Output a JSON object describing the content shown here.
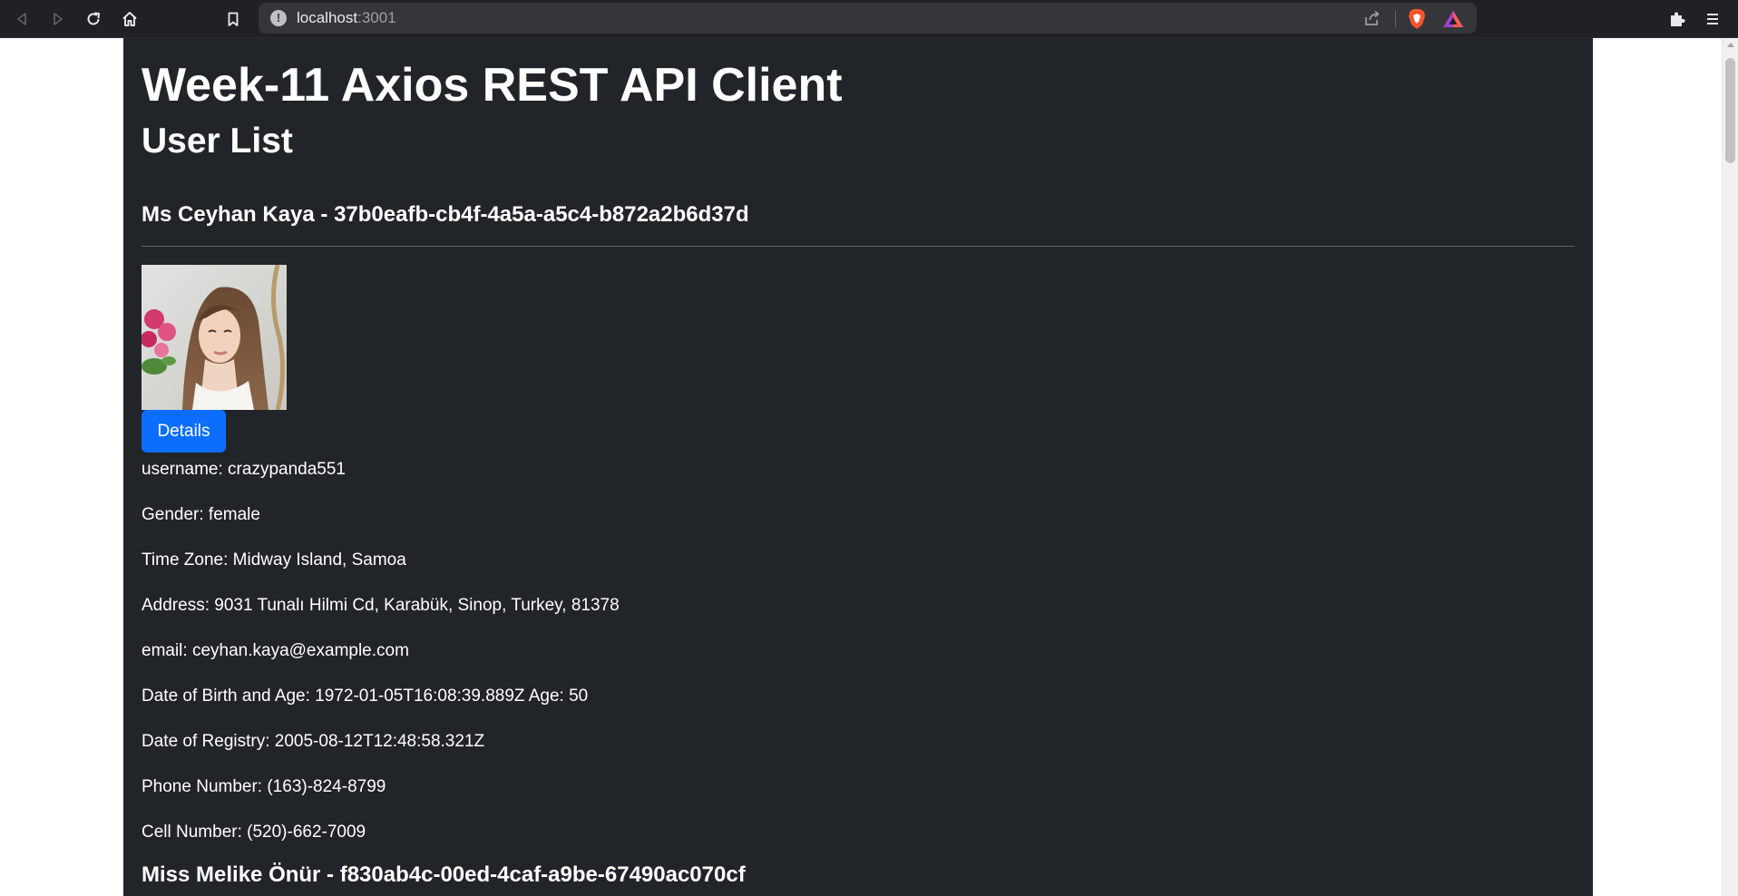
{
  "browser": {
    "url_host": "localhost",
    "url_port": ":3001",
    "icons": {
      "back": "back-arrow-icon",
      "forward": "forward-arrow-icon",
      "reload": "reload-icon",
      "home": "home-icon",
      "bookmark": "bookmark-icon",
      "site_info": "info-icon",
      "share": "share-icon",
      "brave_shields": "brave-shields-icon",
      "brave_rewards": "brave-rewards-icon",
      "extensions": "puzzle-icon",
      "menu": "hamburger-menu-icon"
    }
  },
  "page": {
    "title": "Week-11 Axios REST API Client",
    "subtitle": "User List",
    "colors": {
      "background": "#212529",
      "button": "#0d6efd",
      "text": "#ffffff"
    }
  },
  "users": [
    {
      "heading": "Ms Ceyhan Kaya - 37b0eafb-cb4f-4a5a-a5c4-b872a2b6d37d",
      "button_label": "Details",
      "fields": [
        "username: crazypanda551",
        "Gender: female",
        "Time Zone: Midway Island, Samoa",
        "Address: 9031 Tunalı Hilmi Cd, Karabük, Sinop, Turkey, 81378",
        "email: ceyhan.kaya@example.com",
        "Date of Birth and Age: 1972-01-05T16:08:39.889Z Age: 50",
        "Date of Registry: 2005-08-12T12:48:58.321Z",
        "Phone Number: (163)-824-8799",
        "Cell Number: (520)-662-7009"
      ]
    },
    {
      "heading": "Miss Melike Önür - f830ab4c-00ed-4caf-a9be-67490ac070cf"
    }
  ]
}
